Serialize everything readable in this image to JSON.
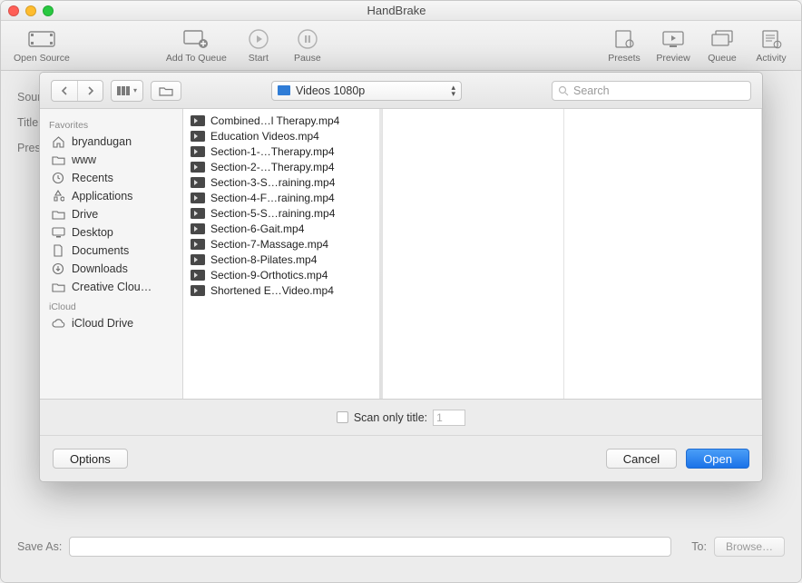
{
  "window": {
    "title": "HandBrake"
  },
  "toolbar": {
    "open_source": "Open Source",
    "add_to_queue": "Add To Queue",
    "start": "Start",
    "pause": "Pause",
    "presets": "Presets",
    "preview": "Preview",
    "queue": "Queue",
    "activity": "Activity"
  },
  "bg_labels": {
    "source": "Sour",
    "title": "Title",
    "preset": "Pres",
    "save_as": "Save As:",
    "to": "To:",
    "browse": "Browse…"
  },
  "dialog": {
    "path_label": "Videos 1080p",
    "search_placeholder": "Search",
    "scan_label": "Scan only title:",
    "scan_value": "1",
    "options": "Options",
    "cancel": "Cancel",
    "open": "Open"
  },
  "sidebar": {
    "sections": [
      {
        "header": "Favorites",
        "items": [
          {
            "icon": "home",
            "label": "bryandugan"
          },
          {
            "icon": "folder",
            "label": "www"
          },
          {
            "icon": "clock",
            "label": "Recents"
          },
          {
            "icon": "apps",
            "label": "Applications"
          },
          {
            "icon": "folder",
            "label": "Drive"
          },
          {
            "icon": "desktop",
            "label": "Desktop"
          },
          {
            "icon": "doc",
            "label": "Documents"
          },
          {
            "icon": "download",
            "label": "Downloads"
          },
          {
            "icon": "folder",
            "label": "Creative Clou…"
          }
        ]
      },
      {
        "header": "iCloud",
        "items": [
          {
            "icon": "cloud",
            "label": "iCloud Drive"
          }
        ]
      }
    ]
  },
  "files": [
    "Combined…l Therapy.mp4",
    "Education Videos.mp4",
    "Section-1-…Therapy.mp4",
    "Section-2-…Therapy.mp4",
    "Section-3-S…raining.mp4",
    "Section-4-F…raining.mp4",
    "Section-5-S…raining.mp4",
    "Section-6-Gait.mp4",
    "Section-7-Massage.mp4",
    "Section-8-Pilates.mp4",
    "Section-9-Orthotics.mp4",
    "Shortened E…Video.mp4"
  ]
}
